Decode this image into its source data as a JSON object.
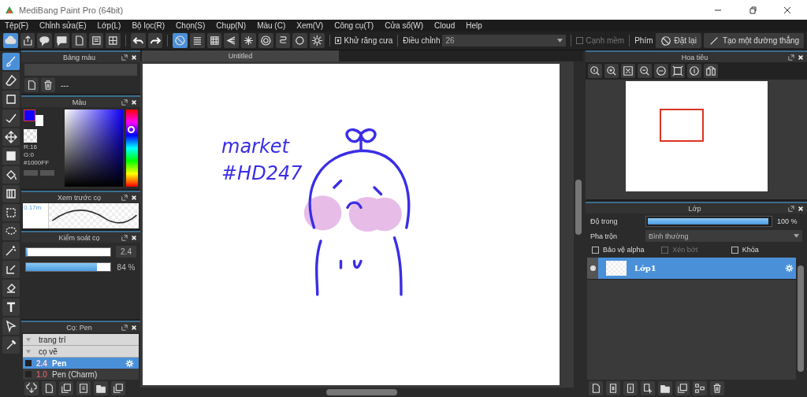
{
  "window": {
    "title": "MediBang Paint Pro (64bit)"
  },
  "menu": [
    "Tệp(F)",
    "Chỉnh sửa(E)",
    "Lớp(L)",
    "Bộ lọc(R)",
    "Chọn(S)",
    "Chụp(N)",
    "Màu (C)",
    "Xem(V)",
    "Công cụ(T)",
    "Cửa sổ(W)",
    "Cloud",
    "Help"
  ],
  "toolbar": {
    "file_tools": [
      {
        "kind": "cloud",
        "selected": true
      },
      {
        "kind": "share",
        "selected": false
      },
      {
        "kind": "speech",
        "selected": false
      },
      {
        "kind": "comment",
        "selected": false
      },
      {
        "kind": "document",
        "selected": false
      },
      {
        "kind": "list",
        "selected": false
      },
      {
        "kind": "grid",
        "selected": false
      }
    ],
    "snaps": [
      {
        "kind": "off",
        "selected": true
      },
      {
        "kind": "parallel",
        "selected": false
      },
      {
        "kind": "gridfine",
        "selected": false
      },
      {
        "kind": "perspective",
        "selected": false
      },
      {
        "kind": "radial",
        "selected": false
      },
      {
        "kind": "concentric",
        "selected": false
      },
      {
        "kind": "curve",
        "selected": false
      },
      {
        "kind": "circle",
        "selected": false
      },
      {
        "kind": "gear",
        "selected": false
      }
    ],
    "antialias": {
      "label": "Khử răng cưa",
      "checked": true
    },
    "correction": {
      "label": "Điều chỉnh",
      "value": "26"
    },
    "soft_edge": {
      "label": "Cạnh mềm",
      "checked": false,
      "disabled": true
    },
    "keys_label": "Phím",
    "reset_button": "Đặt lại",
    "line_button": "Tạo một đường thẳng"
  },
  "tools": [
    {
      "kind": "brush",
      "selected": true
    },
    {
      "kind": "eraser",
      "selected": false
    },
    {
      "kind": "square",
      "selected": false
    },
    {
      "kind": "polyline",
      "selected": false
    },
    {
      "kind": "move",
      "selected": false
    },
    {
      "kind": "fillsquare",
      "selected": false
    },
    {
      "kind": "bucket",
      "selected": false
    },
    {
      "kind": "gradient",
      "selected": false
    },
    {
      "kind": "selrect",
      "selected": false
    },
    {
      "kind": "lasso",
      "selected": false
    },
    {
      "kind": "wand",
      "selected": false
    },
    {
      "kind": "selpen",
      "selected": false
    },
    {
      "kind": "selerase",
      "selected": false
    },
    {
      "kind": "text",
      "selected": false
    },
    {
      "kind": "pointer",
      "selected": false
    },
    {
      "kind": "eyedropper",
      "selected": false
    }
  ],
  "palette_panel": {
    "title": "Bảng màu",
    "entry": "---"
  },
  "color_panel": {
    "title": "Màu",
    "r": "R:16",
    "g": "G:0",
    "hex": "#1000FF",
    "color": "#1000ff",
    "hue": {
      "level": 0.73
    }
  },
  "brush_preview_panel": {
    "title": "Xem trước cọ",
    "size": "0.17m"
  },
  "brush_control_panel": {
    "title": "Kiểm soát cọ",
    "size": {
      "level": 0.02,
      "reading": "2.4"
    },
    "opacity": {
      "level": 0.84,
      "reading": "84 %"
    }
  },
  "brush_panel": {
    "title": "Cọ: Pen",
    "items": [
      {
        "kind": "group",
        "label": "trang trí",
        "expanded": true
      },
      {
        "kind": "group",
        "label": "cọ vẽ",
        "expanded": true
      },
      {
        "kind": "brush",
        "size": "2.4",
        "label": "Pen",
        "selected": true
      },
      {
        "kind": "brush",
        "size": "1.0",
        "label": "Pen (Charm)",
        "selected": false
      }
    ]
  },
  "document_tab": {
    "title": "Untitled"
  },
  "canvas": {
    "caption_1": "market",
    "caption_2": "#HD247"
  },
  "navigator_panel": {
    "title": "Hoa tiêu"
  },
  "layer_panel": {
    "title": "Lớp",
    "opacity": {
      "label": "Độ trong",
      "level": 1,
      "reading": "100 %"
    },
    "blend": {
      "label": "Pha trộn",
      "value": "Bình thường"
    },
    "options": [
      {
        "label": "Bảo vệ alpha",
        "checked": false,
        "disabled": false
      },
      {
        "label": "Xén bớt",
        "checked": false,
        "disabled": true
      },
      {
        "label": "Khóa",
        "checked": false,
        "disabled": false
      }
    ],
    "layers": [
      {
        "name": "Lớp1",
        "visible": true,
        "selected": true
      }
    ]
  }
}
